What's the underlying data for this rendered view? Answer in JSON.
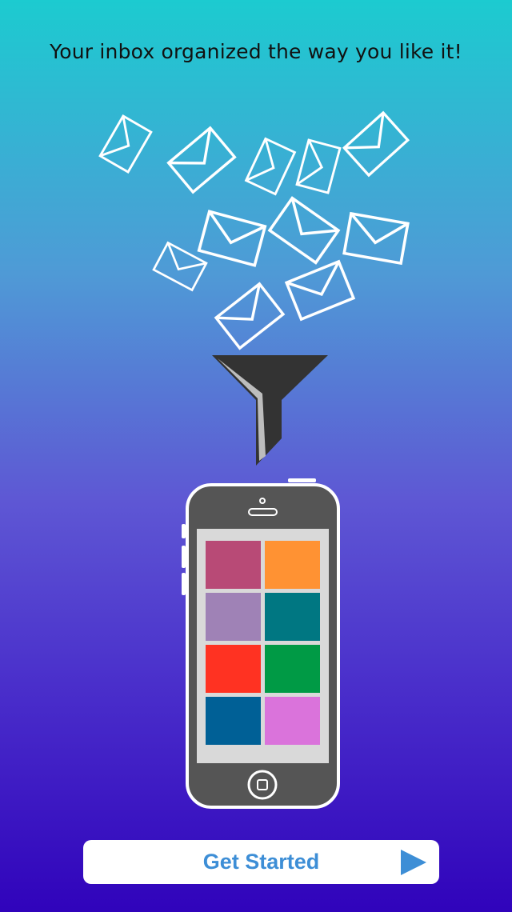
{
  "onboarding": {
    "tagline": "Your inbox organized the way you like it!",
    "cta_label": "Get Started"
  },
  "icons": {
    "envelopes": "envelope-outline-icon",
    "funnel": "funnel-icon",
    "phone": "smartphone-icon",
    "cta_arrow": "play-arrow-icon"
  },
  "colors": {
    "gradient_top": "#1ccbd0",
    "gradient_bottom": "#3003bb",
    "cta_text": "#3d8ed6",
    "cta_arrow": "#3d8ed6",
    "phone_body": "#555555",
    "tiles": [
      "#b84a76",
      "#ff9233",
      "#9f82b6",
      "#007782",
      "#ff3222",
      "#009a45",
      "#006096",
      "#da73db"
    ]
  }
}
